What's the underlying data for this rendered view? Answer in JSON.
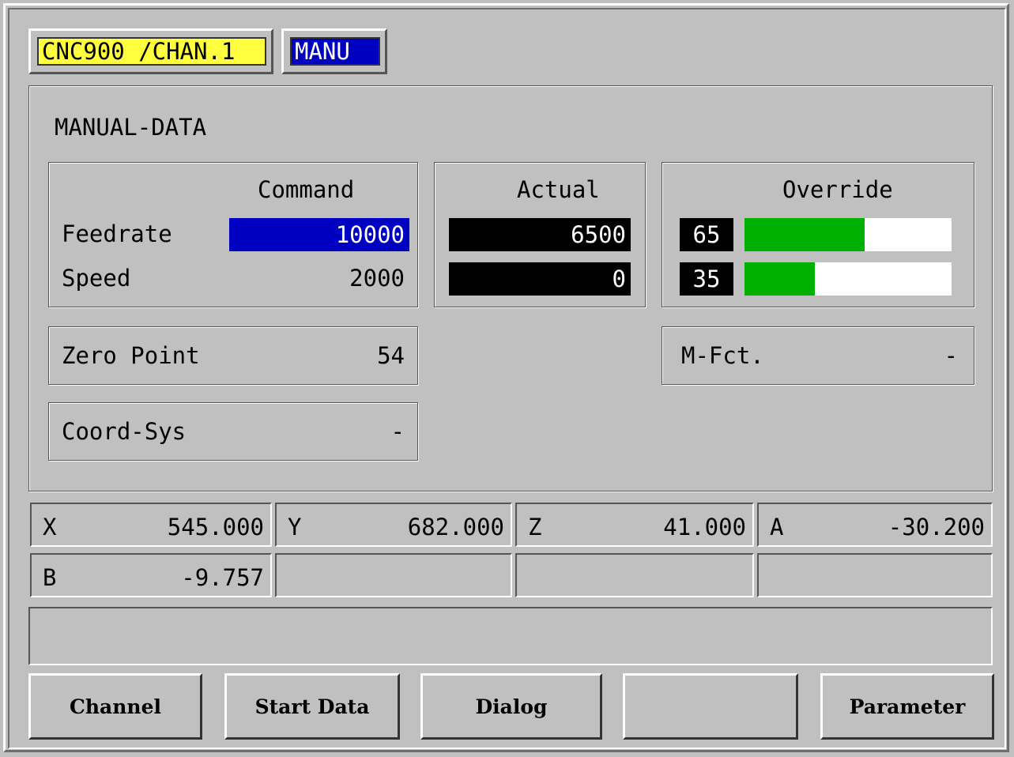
{
  "header": {
    "channel_label": "CNC900 /CHAN.1",
    "mode_label": "MANU",
    "channel_color": "#ffff40",
    "mode_color": "#0000c0"
  },
  "section_title": "MANUAL-DATA",
  "command": {
    "heading": "Command",
    "feedrate_label": "Feedrate",
    "feedrate_value": "10000",
    "speed_label": "Speed",
    "speed_value": "2000"
  },
  "actual": {
    "heading": "Actual",
    "feedrate_value": "6500",
    "speed_value": "0"
  },
  "override": {
    "heading": "Override",
    "feedrate_value": "65",
    "feedrate_fraction": 0.58,
    "speed_value": "35",
    "speed_fraction": 0.34,
    "bar_color": "#00b000"
  },
  "zero_point": {
    "label": "Zero Point",
    "value": "54"
  },
  "coord_sys": {
    "label": "Coord-Sys",
    "value": "-"
  },
  "m_fct": {
    "label": "M-Fct.",
    "value": "-"
  },
  "axes": [
    {
      "label": "X",
      "value": "545.000"
    },
    {
      "label": "Y",
      "value": "682.000"
    },
    {
      "label": "Z",
      "value": "41.000"
    },
    {
      "label": "A",
      "value": "-30.200"
    },
    {
      "label": "B",
      "value": "-9.757"
    },
    {
      "label": "",
      "value": ""
    },
    {
      "label": "",
      "value": ""
    },
    {
      "label": "",
      "value": ""
    }
  ],
  "message_line": "",
  "softkeys": [
    "Channel",
    "Start Data",
    "Dialog",
    "",
    "Parameter"
  ]
}
